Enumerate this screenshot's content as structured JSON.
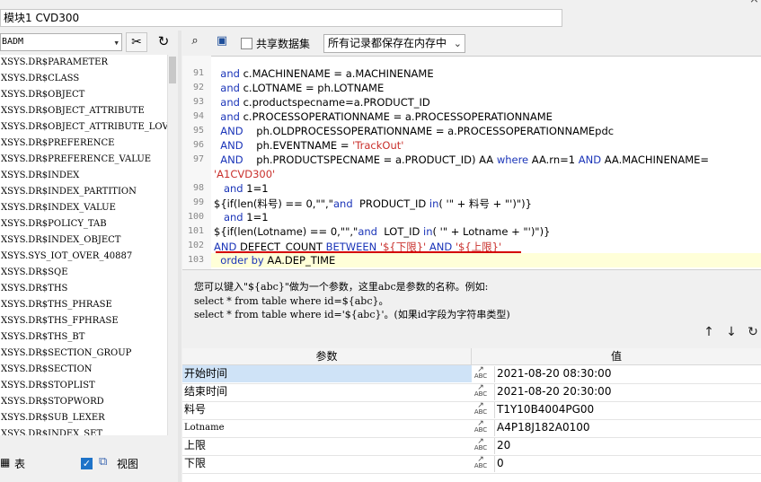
{
  "window": {
    "title": "模块1 CVD300"
  },
  "left_panel": {
    "schema": "BADM",
    "objects": [
      "XSYS.DR$PARAMETER",
      "XSYS.DR$CLASS",
      "XSYS.DR$OBJECT",
      "XSYS.DR$OBJECT_ATTRIBUTE",
      "XSYS.DR$OBJECT_ATTRIBUTE_LOV",
      "XSYS.DR$PREFERENCE",
      "XSYS.DR$PREFERENCE_VALUE",
      "XSYS.DR$INDEX",
      "XSYS.DR$INDEX_PARTITION",
      "XSYS.DR$INDEX_VALUE",
      "XSYS.DR$POLICY_TAB",
      "XSYS.DR$INDEX_OBJECT",
      "XSYS.SYS_IOT_OVER_40887",
      "XSYS.DR$SQE",
      "XSYS.DR$THS",
      "XSYS.DR$THS_PHRASE",
      "XSYS.DR$THS_FPHRASE",
      "XSYS.DR$THS_BT",
      "XSYS.DR$SECTION_GROUP",
      "XSYS.DR$SECTION",
      "XSYS.DR$STOPLIST",
      "XSYS.DR$STOPWORD",
      "XSYS.DR$SUB_LEXER",
      "XSYS.DR$INDEX_SET"
    ],
    "footer": {
      "table_label": "表",
      "view_label": "视图"
    }
  },
  "toolbar": {
    "share_label": "共享数据集",
    "mode_value": "所有记录都保存在内存中"
  },
  "editor": {
    "line_numbers": [
      "91",
      "92",
      "93",
      "94",
      "95",
      "96",
      "97",
      "",
      "98",
      "99",
      "100",
      "101",
      "102",
      "103"
    ],
    "lines": [
      [
        [
          "kw",
          "  and "
        ],
        [
          "t",
          "c.MACHINENAME = a.MACHINENAME"
        ]
      ],
      [
        [
          "kw",
          "  and "
        ],
        [
          "t",
          "c.LOTNAME = ph.LOTNAME"
        ]
      ],
      [
        [
          "kw",
          "  and "
        ],
        [
          "t",
          "c.productspecname=a.PRODUCT_ID"
        ]
      ],
      [
        [
          "kw",
          "  and "
        ],
        [
          "t",
          "c.PROCESSOPERATIONNAME = a.PROCESSOPERATIONNAME"
        ]
      ],
      [
        [
          "kw",
          "  AND    "
        ],
        [
          "t",
          "ph.OLDPROCESSOPERATIONNAME = a.PROCESSOPERATIONNAMEpdc"
        ]
      ],
      [
        [
          "kw",
          "  AND    "
        ],
        [
          "t",
          "ph.EVENTNAME = "
        ],
        [
          "str",
          "'TrackOut'"
        ]
      ],
      [
        [
          "kw",
          "  AND    "
        ],
        [
          "t",
          "ph.PRODUCTSPECNAME = a.PRODUCT_ID) AA "
        ],
        [
          "kw",
          "where "
        ],
        [
          "t",
          "AA.rn=1 "
        ],
        [
          "kw",
          "AND "
        ],
        [
          "t",
          "AA.MACHINENAME="
        ]
      ],
      [
        [
          "str",
          "'A1CVD300'"
        ]
      ],
      [
        [
          "kw",
          "   and "
        ],
        [
          "t",
          "1=1"
        ]
      ],
      [
        [
          "t",
          "${if(len(料号) == 0,\"\",\""
        ],
        [
          "kw",
          "and  "
        ],
        [
          "t",
          "PRODUCT_ID "
        ],
        [
          "kw",
          "in"
        ],
        [
          "t",
          "( '\" + 料号 + \"')\")}"
        ]
      ],
      [
        [
          "kw",
          "   and "
        ],
        [
          "t",
          "1=1"
        ]
      ],
      [
        [
          "t",
          "${if(len(Lotname) == 0,\"\",\""
        ],
        [
          "kw",
          "and  "
        ],
        [
          "t",
          "LOT_ID "
        ],
        [
          "kw",
          "in"
        ],
        [
          "t",
          "( '\" + Lotname + \"')\")}"
        ]
      ],
      [
        [
          "kw",
          "AND "
        ],
        [
          "t",
          "DEFECT_COUNT "
        ],
        [
          "kw",
          "BETWEEN "
        ],
        [
          "str",
          "'${下限}' "
        ],
        [
          "kw",
          "AND "
        ],
        [
          "str",
          "'${上限}'"
        ]
      ],
      [
        [
          "kw",
          "  order by "
        ],
        [
          "t",
          "AA.DEP_TIME"
        ]
      ]
    ]
  },
  "help": {
    "line1": "您可以键入\"${abc}\"做为一个参数，这里abc是参数的名称。例如:",
    "line2": "select * from table where id=${abc}。",
    "line3": "select * from table where id='${abc}'。(如果id字段为字符串类型)"
  },
  "params": {
    "header_name": "参数",
    "header_value": "值",
    "rows": [
      {
        "name": "开始时间",
        "value": "2021-08-20 08:30:00"
      },
      {
        "name": "结束时间",
        "value": "2021-08-20 20:30:00"
      },
      {
        "name": "料号",
        "value": "T1Y10B4004PG00"
      },
      {
        "name": "Lotname",
        "value": "A4P18J182A0100"
      },
      {
        "name": "上限",
        "value": "20"
      },
      {
        "name": "下限",
        "value": "0"
      }
    ]
  }
}
